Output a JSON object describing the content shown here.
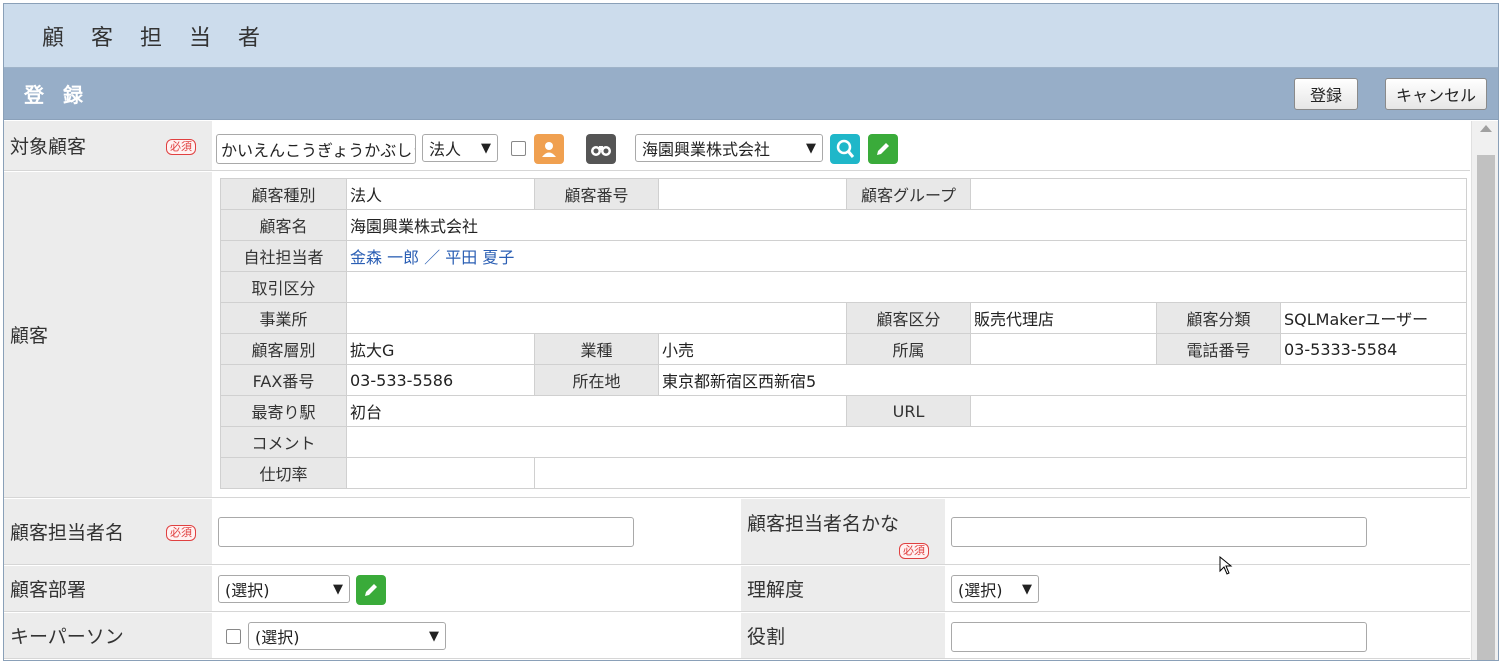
{
  "header": {
    "title": "顧 客 担 当 者"
  },
  "subheader": {
    "title": "登 録",
    "register_label": "登録",
    "cancel_label": "キャンセル"
  },
  "required_label": "必須",
  "target_customer": {
    "label": "対象顧客",
    "kana_value": "かいえんこうぎょうかぶしきが",
    "type_select": "法人",
    "company_select": "海園興業株式会社"
  },
  "customer": {
    "label": "顧客",
    "fields": {
      "type_label": "顧客種別",
      "type_value": "法人",
      "number_label": "顧客番号",
      "number_value": "",
      "group_label": "顧客グループ",
      "group_value": "",
      "name_label": "顧客名",
      "name_value": "海園興業株式会社",
      "owner_label": "自社担当者",
      "owner_value": "金森 一郎 ／ 平田 夏子",
      "trade_label": "取引区分",
      "trade_value": "",
      "office_label": "事業所",
      "office_value": "",
      "class_label": "顧客区分",
      "class_value": "販売代理店",
      "category_label": "顧客分類",
      "category_value": "SQLMakerユーザー",
      "tier_label": "顧客層別",
      "tier_value": "拡大G",
      "industry_label": "業種",
      "industry_value": "小売",
      "affiliation_label": "所属",
      "affiliation_value": "",
      "phone_label": "電話番号",
      "phone_value": "03-5333-5584",
      "fax_label": "FAX番号",
      "fax_value": "03-533-5586",
      "address_label": "所在地",
      "address_value": "東京都新宿区西新宿5",
      "station_label": "最寄り駅",
      "station_value": "初台",
      "url_label": "URL",
      "url_value": "",
      "comment_label": "コメント",
      "comment_value": "",
      "rate_label": "仕切率",
      "rate_value": ""
    }
  },
  "contact_name": {
    "label": "顧客担当者名",
    "value": ""
  },
  "contact_kana": {
    "label": "顧客担当者名かな",
    "value": ""
  },
  "department": {
    "label": "顧客部署",
    "select": "(選択)"
  },
  "understanding": {
    "label": "理解度",
    "select": "(選択)"
  },
  "key_person": {
    "label": "キーパーソン",
    "select": "(選択)"
  },
  "role": {
    "label": "役割",
    "value": ""
  },
  "colors": {
    "header_bg": "#ccdcec",
    "subheader_bg": "#97aec8",
    "link": "#2b5fb4",
    "required": "#e04040",
    "edit_green": "#3aab3a",
    "search_teal": "#1fb7c9",
    "person_orange": "#f0a050"
  }
}
